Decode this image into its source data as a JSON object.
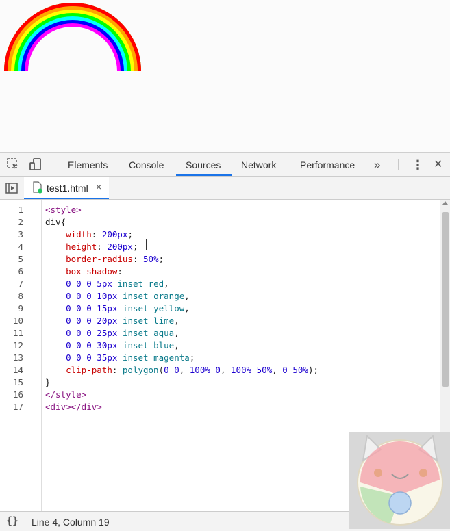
{
  "toolbar": {
    "tabs": [
      "Elements",
      "Console",
      "Sources",
      "Network",
      "Performance"
    ],
    "active_tab": "Sources",
    "more": "»",
    "menu": "⋮",
    "close": "✕"
  },
  "file_tab": {
    "name": "test1.html",
    "close": "×"
  },
  "code": {
    "lines": [
      "<style>",
      "div{",
      "    width: 200px;",
      "    height: 200px;",
      "    border-radius: 50%;",
      "    box-shadow:",
      "    0 0 0 5px inset red,",
      "    0 0 0 10px inset orange,",
      "    0 0 0 15px inset yellow,",
      "    0 0 0 20px inset lime,",
      "    0 0 0 25px inset aqua,",
      "    0 0 0 30px inset blue,",
      "    0 0 0 35px inset magenta;",
      "    clip-path: polygon(0 0, 100% 0, 100% 50%, 0 50%);",
      "}",
      "</style>",
      "<div></div>"
    ]
  },
  "status": {
    "braces": "{}",
    "position": "Line 4, Column 19"
  },
  "colors": {
    "accent": "#1a73e8",
    "toolbar_bg": "#f3f3f3"
  },
  "icons": [
    "inspect-icon",
    "device-toggle-icon",
    "navigator-toggle-icon",
    "more-tabs-icon",
    "kebab-menu-icon",
    "close-icon",
    "file-icon",
    "format-icon",
    "scroll-icon"
  ]
}
